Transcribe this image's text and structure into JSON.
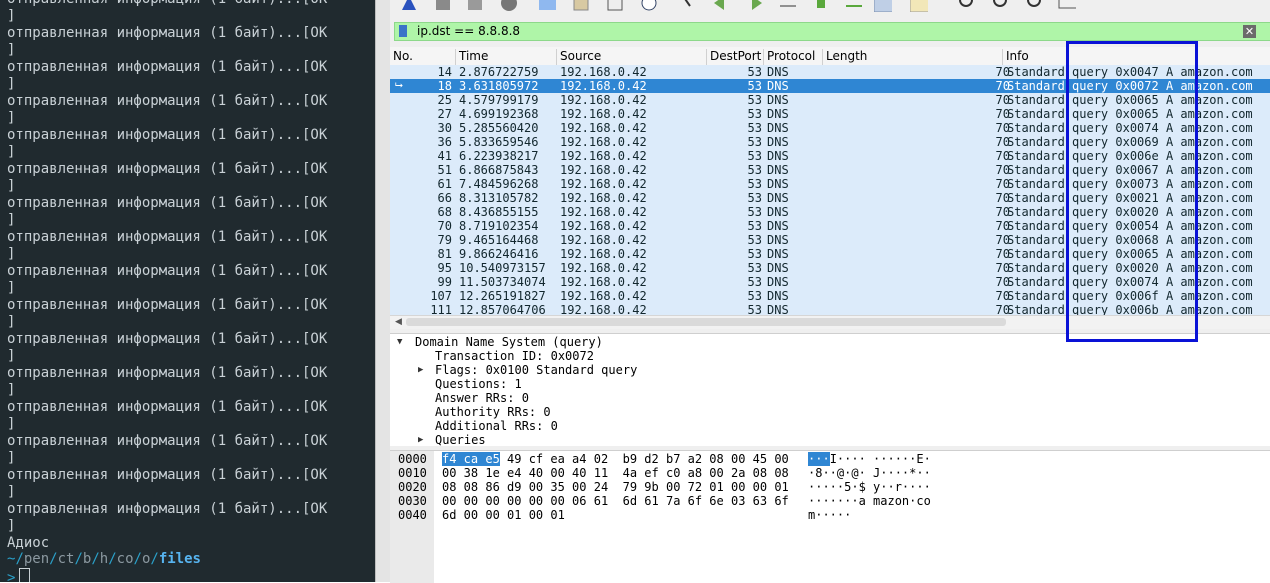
{
  "terminal": {
    "lines": [
      "отправленная информация (1 байт)...[OK",
      "]",
      "отправленная информация (1 байт)...[OK",
      "]",
      "отправленная информация (1 байт)...[OK",
      "]",
      "отправленная информация (1 байт)...[OK",
      "]",
      "отправленная информация (1 байт)...[OK",
      "]",
      "отправленная информация (1 байт)...[OK",
      "]",
      "отправленная информация (1 байт)...[OK",
      "]",
      "отправленная информация (1 байт)...[OK",
      "]",
      "отправленная информация (1 байт)...[OK",
      "]",
      "отправленная информация (1 байт)...[OK",
      "]",
      "отправленная информация (1 байт)...[OK",
      "]",
      "отправленная информация (1 байт)...[OK",
      "]",
      "отправленная информация (1 байт)...[OK",
      "]",
      "отправленная информация (1 байт)...[OK",
      "]",
      "отправленная информация (1 байт)...[OK",
      "]",
      "отправленная информация (1 байт)...[OK",
      "]",
      "Адиос"
    ],
    "prompt_path": {
      "home": "~",
      "s1": "/",
      "p1": "pen",
      "s2": "/",
      "p2": "ct",
      "s3": "/",
      "p3": "b",
      "s4": "/",
      "p4": "h",
      "s5": "/",
      "p5": "co",
      "s6": "/",
      "p6": "o",
      "s7": "/",
      "final": "files"
    },
    "prompt_char": ">"
  },
  "filter": {
    "value": "ip.dst == 8.8.8.8",
    "clear": "✕"
  },
  "columns": {
    "no": "No.",
    "time": "Time",
    "source": "Source",
    "destport": "DestPort",
    "protocol": "Protocol",
    "length": "Length",
    "info": "Info"
  },
  "packets": [
    {
      "no": "14",
      "time": "2.876722759",
      "src": "192.168.0.42",
      "dport": "53",
      "proto": "DNS",
      "len": "70",
      "info": "Standard query 0x0047 A amazon.com"
    },
    {
      "no": "18",
      "time": "3.631805972",
      "src": "192.168.0.42",
      "dport": "53",
      "proto": "DNS",
      "len": "70",
      "info": "Standard query 0x0072 A amazon.com",
      "selected": true
    },
    {
      "no": "25",
      "time": "4.579799179",
      "src": "192.168.0.42",
      "dport": "53",
      "proto": "DNS",
      "len": "70",
      "info": "Standard query 0x0065 A amazon.com"
    },
    {
      "no": "27",
      "time": "4.699192368",
      "src": "192.168.0.42",
      "dport": "53",
      "proto": "DNS",
      "len": "70",
      "info": "Standard query 0x0065 A amazon.com"
    },
    {
      "no": "30",
      "time": "5.285560420",
      "src": "192.168.0.42",
      "dport": "53",
      "proto": "DNS",
      "len": "70",
      "info": "Standard query 0x0074 A amazon.com"
    },
    {
      "no": "36",
      "time": "5.833659546",
      "src": "192.168.0.42",
      "dport": "53",
      "proto": "DNS",
      "len": "70",
      "info": "Standard query 0x0069 A amazon.com"
    },
    {
      "no": "41",
      "time": "6.223938217",
      "src": "192.168.0.42",
      "dport": "53",
      "proto": "DNS",
      "len": "70",
      "info": "Standard query 0x006e A amazon.com"
    },
    {
      "no": "51",
      "time": "6.866875843",
      "src": "192.168.0.42",
      "dport": "53",
      "proto": "DNS",
      "len": "70",
      "info": "Standard query 0x0067 A amazon.com"
    },
    {
      "no": "61",
      "time": "7.484596268",
      "src": "192.168.0.42",
      "dport": "53",
      "proto": "DNS",
      "len": "70",
      "info": "Standard query 0x0073 A amazon.com"
    },
    {
      "no": "66",
      "time": "8.313105782",
      "src": "192.168.0.42",
      "dport": "53",
      "proto": "DNS",
      "len": "70",
      "info": "Standard query 0x0021 A amazon.com"
    },
    {
      "no": "68",
      "time": "8.436855155",
      "src": "192.168.0.42",
      "dport": "53",
      "proto": "DNS",
      "len": "70",
      "info": "Standard query 0x0020 A amazon.com"
    },
    {
      "no": "70",
      "time": "8.719102354",
      "src": "192.168.0.42",
      "dport": "53",
      "proto": "DNS",
      "len": "70",
      "info": "Standard query 0x0054 A amazon.com"
    },
    {
      "no": "79",
      "time": "9.465164468",
      "src": "192.168.0.42",
      "dport": "53",
      "proto": "DNS",
      "len": "70",
      "info": "Standard query 0x0068 A amazon.com"
    },
    {
      "no": "81",
      "time": "9.866246416",
      "src": "192.168.0.42",
      "dport": "53",
      "proto": "DNS",
      "len": "70",
      "info": "Standard query 0x0065 A amazon.com"
    },
    {
      "no": "95",
      "time": "10.540973157",
      "src": "192.168.0.42",
      "dport": "53",
      "proto": "DNS",
      "len": "70",
      "info": "Standard query 0x0020 A amazon.com"
    },
    {
      "no": "99",
      "time": "11.503734074",
      "src": "192.168.0.42",
      "dport": "53",
      "proto": "DNS",
      "len": "70",
      "info": "Standard query 0x0074 A amazon.com"
    },
    {
      "no": "107",
      "time": "12.265191827",
      "src": "192.168.0.42",
      "dport": "53",
      "proto": "DNS",
      "len": "70",
      "info": "Standard query 0x006f A amazon.com"
    },
    {
      "no": "111",
      "time": "12.857064706",
      "src": "192.168.0.42",
      "dport": "53",
      "proto": "DNS",
      "len": "70",
      "info": "Standard query 0x006b A amazon.com"
    }
  ],
  "details": {
    "root": "Domain Name System (query)",
    "txid": "Transaction ID: 0x0072",
    "flags": "Flags: 0x0100 Standard query",
    "questions": "Questions: 1",
    "answers": "Answer RRs: 0",
    "authority": "Authority RRs: 0",
    "additional": "Additional RRs: 0",
    "queries": "Queries"
  },
  "hex": {
    "offsets": [
      "0000",
      "0010",
      "0020",
      "0030",
      "0040"
    ],
    "row0_sel": "f4 ca e5",
    "row0_rest": " 49 cf ea a4 02  b9 d2 b7 a2 08 00 45 00",
    "row1": "00 38 1e e4 40 00 40 11  4a ef c0 a8 00 2a 08 08",
    "row2": "08 08 86 d9 00 35 00 24  79 9b 00 72 01 00 00 01",
    "row3": "00 00 00 00 00 00 06 61  6d 61 7a 6f 6e 03 63 6f",
    "row4": "6d 00 00 01 00 01",
    "ascii0_sel": "···",
    "ascii0_rest": "I···· ······E·",
    "ascii1": "·8··@·@· J····*··",
    "ascii2": "·····5·$ y··r····",
    "ascii3": "·······a mazon·co",
    "ascii4": "m·····"
  },
  "colors": {
    "selected_row": "#2f86d3",
    "row_bg": "#dcebfa",
    "filter_bg": "#aff5a8",
    "annotation": "#0a12d6",
    "terminal_bg": "#202a2f"
  }
}
